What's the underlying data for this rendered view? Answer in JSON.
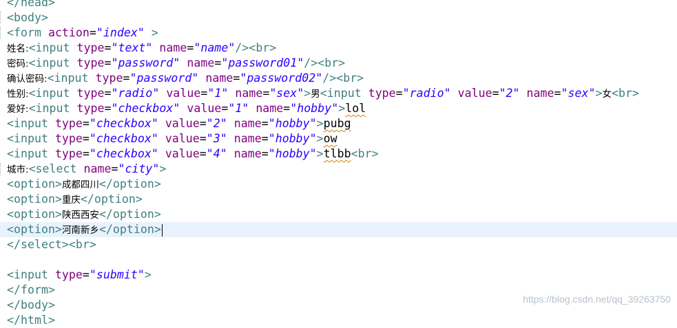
{
  "editor": {
    "lines": [
      {
        "tokens": [
          {
            "t": "</head>",
            "c": "tag"
          }
        ]
      },
      {
        "tokens": [
          {
            "t": "<body>",
            "c": "tag"
          }
        ]
      },
      {
        "tokens": [
          {
            "t": "<form ",
            "c": "tag"
          },
          {
            "t": "action",
            "c": "attr"
          },
          {
            "t": "=",
            "c": "text"
          },
          {
            "t": "\"index\"",
            "c": "val"
          },
          {
            "t": " >",
            "c": "tag"
          }
        ]
      },
      {
        "tokens": [
          {
            "t": "姓名:",
            "c": "cjk"
          },
          {
            "t": "<input ",
            "c": "tag"
          },
          {
            "t": "type",
            "c": "attr"
          },
          {
            "t": "=",
            "c": "text"
          },
          {
            "t": "\"text\"",
            "c": "val"
          },
          {
            "t": " ",
            "c": "text"
          },
          {
            "t": "name",
            "c": "attr"
          },
          {
            "t": "=",
            "c": "text"
          },
          {
            "t": "\"name\"",
            "c": "val"
          },
          {
            "t": "/><br>",
            "c": "tag"
          }
        ]
      },
      {
        "tokens": [
          {
            "t": "密码:",
            "c": "cjk"
          },
          {
            "t": "<input ",
            "c": "tag"
          },
          {
            "t": "type",
            "c": "attr"
          },
          {
            "t": "=",
            "c": "text"
          },
          {
            "t": "\"password\"",
            "c": "val"
          },
          {
            "t": " ",
            "c": "text"
          },
          {
            "t": "name",
            "c": "attr"
          },
          {
            "t": "=",
            "c": "text"
          },
          {
            "t": "\"password01\"",
            "c": "val"
          },
          {
            "t": "/><br>",
            "c": "tag"
          }
        ]
      },
      {
        "tokens": [
          {
            "t": "确认密码:",
            "c": "cjk"
          },
          {
            "t": "<input ",
            "c": "tag"
          },
          {
            "t": "type",
            "c": "attr"
          },
          {
            "t": "=",
            "c": "text"
          },
          {
            "t": "\"password\"",
            "c": "val"
          },
          {
            "t": " ",
            "c": "text"
          },
          {
            "t": "name",
            "c": "attr"
          },
          {
            "t": "=",
            "c": "text"
          },
          {
            "t": "\"password02\"",
            "c": "val"
          },
          {
            "t": "/><br>",
            "c": "tag"
          }
        ]
      },
      {
        "tokens": [
          {
            "t": "性别:",
            "c": "cjk"
          },
          {
            "t": "<input ",
            "c": "tag"
          },
          {
            "t": "type",
            "c": "attr"
          },
          {
            "t": "=",
            "c": "text"
          },
          {
            "t": "\"radio\"",
            "c": "val"
          },
          {
            "t": " ",
            "c": "text"
          },
          {
            "t": "value",
            "c": "attr"
          },
          {
            "t": "=",
            "c": "text"
          },
          {
            "t": "\"1\"",
            "c": "val"
          },
          {
            "t": " ",
            "c": "text"
          },
          {
            "t": "name",
            "c": "attr"
          },
          {
            "t": "=",
            "c": "text"
          },
          {
            "t": "\"sex\"",
            "c": "val"
          },
          {
            "t": ">",
            "c": "tag"
          },
          {
            "t": "男",
            "c": "cjk"
          },
          {
            "t": "<input ",
            "c": "tag"
          },
          {
            "t": "type",
            "c": "attr"
          },
          {
            "t": "=",
            "c": "text"
          },
          {
            "t": "\"radio\"",
            "c": "val"
          },
          {
            "t": " ",
            "c": "text"
          },
          {
            "t": "value",
            "c": "attr"
          },
          {
            "t": "=",
            "c": "text"
          },
          {
            "t": "\"2\"",
            "c": "val"
          },
          {
            "t": " ",
            "c": "text"
          },
          {
            "t": "name",
            "c": "attr"
          },
          {
            "t": "=",
            "c": "text"
          },
          {
            "t": "\"sex\"",
            "c": "val"
          },
          {
            "t": ">",
            "c": "tag"
          },
          {
            "t": "女",
            "c": "cjk"
          },
          {
            "t": "<br>",
            "c": "tag"
          }
        ]
      },
      {
        "tokens": [
          {
            "t": "爱好:",
            "c": "cjk"
          },
          {
            "t": "<input ",
            "c": "tag"
          },
          {
            "t": "type",
            "c": "attr"
          },
          {
            "t": "=",
            "c": "text"
          },
          {
            "t": "\"checkbox\"",
            "c": "val"
          },
          {
            "t": " ",
            "c": "text"
          },
          {
            "t": "value",
            "c": "attr"
          },
          {
            "t": "=",
            "c": "text"
          },
          {
            "t": "\"1\"",
            "c": "val"
          },
          {
            "t": " ",
            "c": "text"
          },
          {
            "t": "name",
            "c": "attr"
          },
          {
            "t": "=",
            "c": "text"
          },
          {
            "t": "\"hobby\"",
            "c": "val"
          },
          {
            "t": ">",
            "c": "tag"
          },
          {
            "t": "lol",
            "c": "sq"
          }
        ]
      },
      {
        "tokens": [
          {
            "t": "<input ",
            "c": "tag"
          },
          {
            "t": "type",
            "c": "attr"
          },
          {
            "t": "=",
            "c": "text"
          },
          {
            "t": "\"checkbox\"",
            "c": "val"
          },
          {
            "t": " ",
            "c": "text"
          },
          {
            "t": "value",
            "c": "attr"
          },
          {
            "t": "=",
            "c": "text"
          },
          {
            "t": "\"2\"",
            "c": "val"
          },
          {
            "t": " ",
            "c": "text"
          },
          {
            "t": "name",
            "c": "attr"
          },
          {
            "t": "=",
            "c": "text"
          },
          {
            "t": "\"hobby\"",
            "c": "val"
          },
          {
            "t": ">",
            "c": "tag"
          },
          {
            "t": "pubg",
            "c": "sq"
          }
        ]
      },
      {
        "tokens": [
          {
            "t": "<input ",
            "c": "tag"
          },
          {
            "t": "type",
            "c": "attr"
          },
          {
            "t": "=",
            "c": "text"
          },
          {
            "t": "\"checkbox\"",
            "c": "val"
          },
          {
            "t": " ",
            "c": "text"
          },
          {
            "t": "value",
            "c": "attr"
          },
          {
            "t": "=",
            "c": "text"
          },
          {
            "t": "\"3\"",
            "c": "val"
          },
          {
            "t": " ",
            "c": "text"
          },
          {
            "t": "name",
            "c": "attr"
          },
          {
            "t": "=",
            "c": "text"
          },
          {
            "t": "\"hobby\"",
            "c": "val"
          },
          {
            "t": ">",
            "c": "tag"
          },
          {
            "t": "ow",
            "c": "sq"
          }
        ]
      },
      {
        "tokens": [
          {
            "t": "<input ",
            "c": "tag"
          },
          {
            "t": "type",
            "c": "attr"
          },
          {
            "t": "=",
            "c": "text"
          },
          {
            "t": "\"checkbox\"",
            "c": "val"
          },
          {
            "t": " ",
            "c": "text"
          },
          {
            "t": "value",
            "c": "attr"
          },
          {
            "t": "=",
            "c": "text"
          },
          {
            "t": "\"4\"",
            "c": "val"
          },
          {
            "t": " ",
            "c": "text"
          },
          {
            "t": "name",
            "c": "attr"
          },
          {
            "t": "=",
            "c": "text"
          },
          {
            "t": "\"hobby\"",
            "c": "val"
          },
          {
            "t": ">",
            "c": "tag"
          },
          {
            "t": "tlbb",
            "c": "sq"
          },
          {
            "t": "<br>",
            "c": "tag"
          }
        ]
      },
      {
        "tokens": [
          {
            "t": "城市:",
            "c": "cjk"
          },
          {
            "t": "<select ",
            "c": "tag"
          },
          {
            "t": "name",
            "c": "attr"
          },
          {
            "t": "=",
            "c": "text"
          },
          {
            "t": "\"city\"",
            "c": "val"
          },
          {
            "t": ">",
            "c": "tag"
          }
        ]
      },
      {
        "tokens": [
          {
            "t": "<option>",
            "c": "tag"
          },
          {
            "t": "成都四川",
            "c": "cjk"
          },
          {
            "t": "</option>",
            "c": "tag"
          }
        ]
      },
      {
        "tokens": [
          {
            "t": "<option>",
            "c": "tag"
          },
          {
            "t": "重庆",
            "c": "cjk"
          },
          {
            "t": "</option>",
            "c": "tag"
          }
        ]
      },
      {
        "tokens": [
          {
            "t": "<option>",
            "c": "tag"
          },
          {
            "t": "陕西西安",
            "c": "cjk"
          },
          {
            "t": "</option>",
            "c": "tag"
          }
        ]
      },
      {
        "tokens": [
          {
            "t": "<option>",
            "c": "tag"
          },
          {
            "t": "河南新乡",
            "c": "cjk"
          },
          {
            "t": "</option>",
            "c": "tag"
          }
        ],
        "current": true
      },
      {
        "tokens": [
          {
            "t": "</select><br>",
            "c": "tag"
          }
        ]
      },
      {
        "tokens": []
      },
      {
        "tokens": [
          {
            "t": "<input ",
            "c": "tag"
          },
          {
            "t": "type",
            "c": "attr"
          },
          {
            "t": "=",
            "c": "text"
          },
          {
            "t": "\"submit\"",
            "c": "val"
          },
          {
            "t": ">",
            "c": "tag"
          }
        ]
      },
      {
        "tokens": [
          {
            "t": "</form>",
            "c": "tag"
          }
        ]
      },
      {
        "tokens": [
          {
            "t": "</body>",
            "c": "tag"
          }
        ]
      },
      {
        "tokens": [
          {
            "t": "</html>",
            "c": "tag"
          }
        ]
      }
    ]
  },
  "watermark": "https://blog.csdn.net/qq_39263750",
  "colors": {
    "tag": "#3f7f7f",
    "attribute": "#7f007f",
    "value": "#2a00ff",
    "current_line": "#e8f2fe"
  }
}
